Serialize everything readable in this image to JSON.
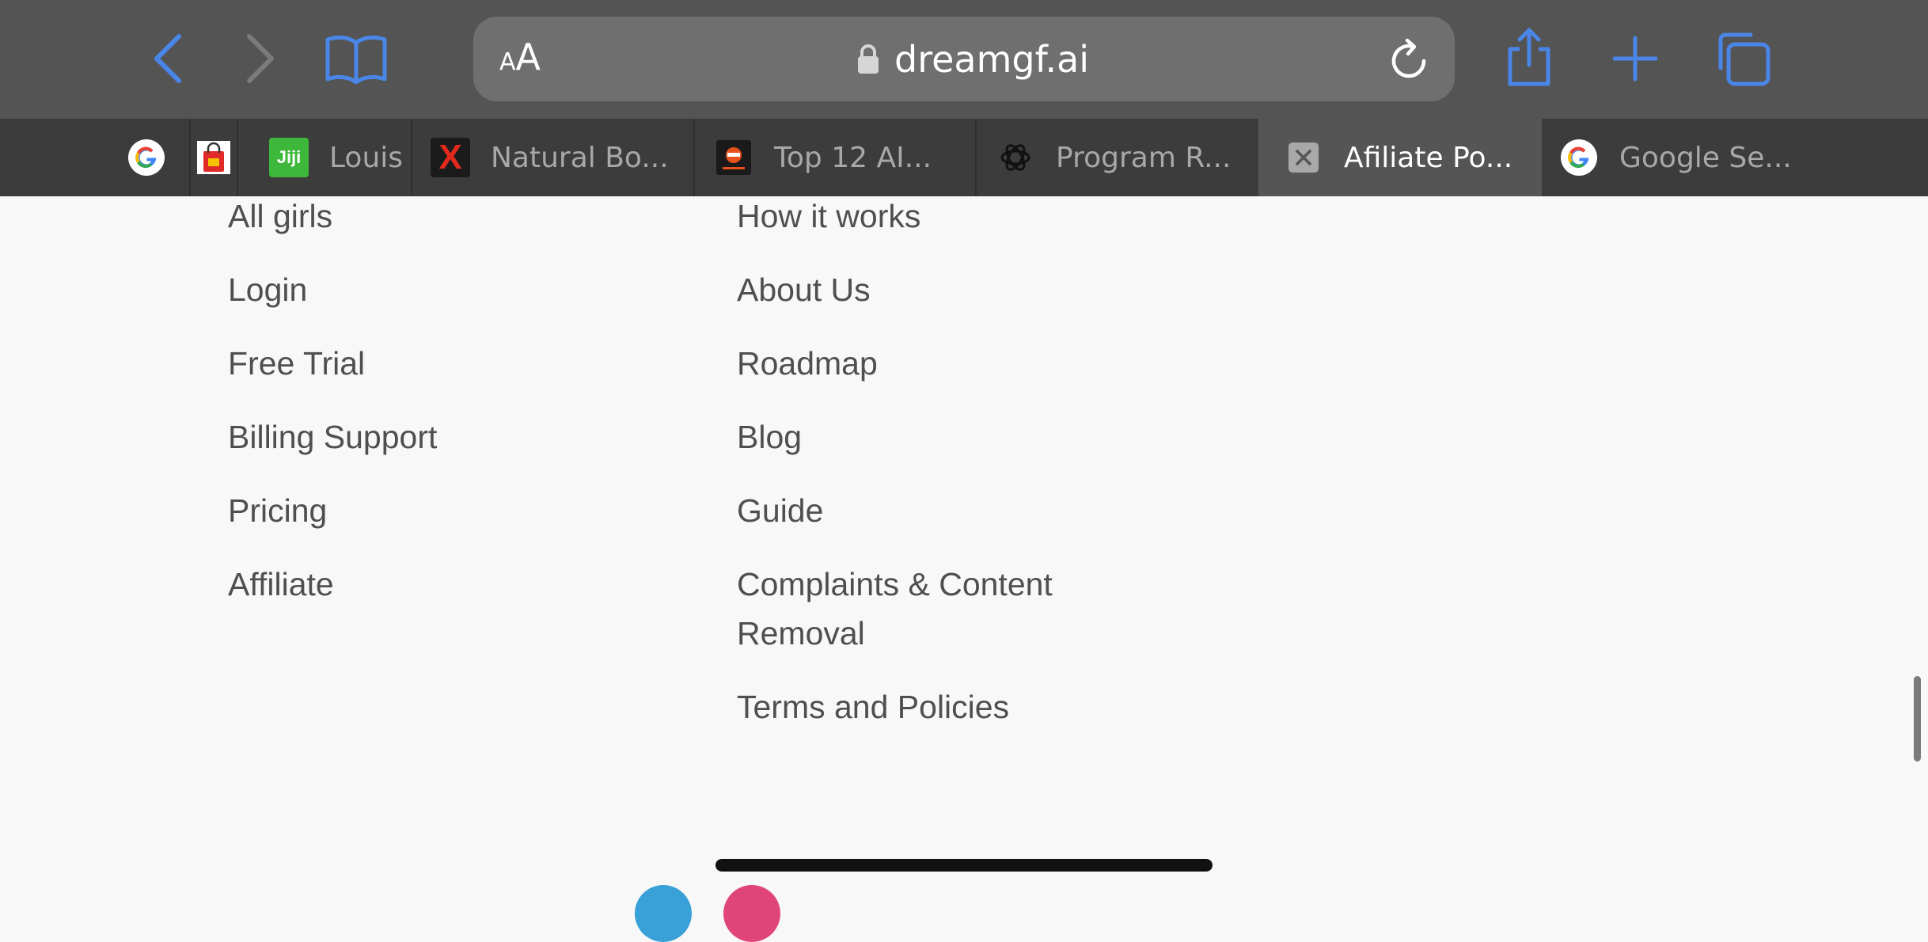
{
  "browser": {
    "text_size_label_small": "A",
    "text_size_label_large": "A",
    "url": "dreamgf.ai",
    "accent_color": "#4a86e8",
    "icons": [
      "back-icon",
      "forward-icon",
      "bookmarks-icon",
      "lock-icon",
      "reload-icon",
      "share-icon",
      "new-tab-icon",
      "tabs-overview-icon"
    ]
  },
  "tabs": [
    {
      "title": "",
      "favicon": "google-icon"
    },
    {
      "title": "",
      "favicon": "shopping-bag-icon"
    },
    {
      "title": "Louis",
      "favicon": "jiji-icon",
      "favicon_text": "Jiji"
    },
    {
      "title": "Natural Bo...",
      "favicon": "x-icon",
      "favicon_text": "X"
    },
    {
      "title": "Top 12 AI...",
      "favicon": "site-icon"
    },
    {
      "title": "Program R...",
      "favicon": "openai-icon"
    },
    {
      "title": "Afiliate Po...",
      "favicon": "close-tab-icon",
      "active": true
    },
    {
      "title": "Google Se...",
      "favicon": "google-icon"
    }
  ],
  "footer": {
    "left_links": [
      "All girls",
      "Login",
      "Free Trial",
      "Billing Support",
      "Pricing",
      "Affiliate"
    ],
    "right_links": [
      "How it works",
      "About Us",
      "Roadmap",
      "Blog",
      "Guide",
      "Complaints & Content Removal",
      "Terms and Policies"
    ]
  }
}
